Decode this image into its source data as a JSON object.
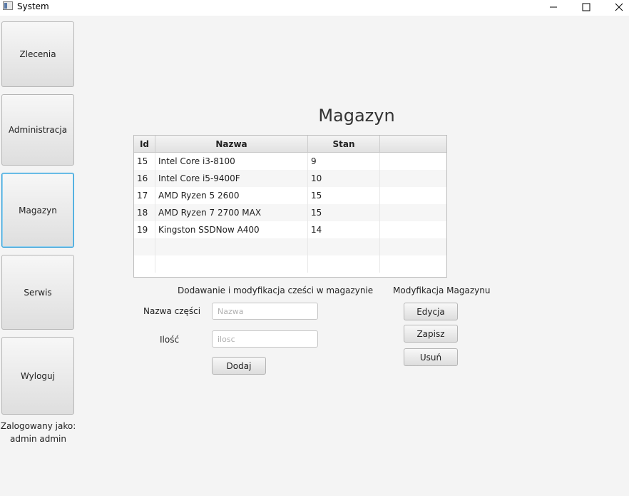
{
  "window": {
    "title": "System"
  },
  "sidebar": {
    "items": [
      {
        "label": "Zlecenia"
      },
      {
        "label": "Administracja"
      },
      {
        "label": "Magazyn"
      },
      {
        "label": "Serwis"
      },
      {
        "label": "Wyloguj"
      }
    ],
    "logged_label": "Zalogowany jako:",
    "logged_user": "admin admin"
  },
  "main": {
    "title": "Magazyn",
    "table": {
      "columns": [
        "Id",
        "Nazwa",
        "Stan",
        ""
      ],
      "rows": [
        {
          "id": "15",
          "nazwa": "Intel Core i3-8100",
          "stan": "9"
        },
        {
          "id": "16",
          "nazwa": "Intel Core i5-9400F",
          "stan": "10"
        },
        {
          "id": "17",
          "nazwa": "AMD Ryzen 5 2600",
          "stan": "15"
        },
        {
          "id": "18",
          "nazwa": "AMD Ryzen 7 2700 MAX",
          "stan": "15"
        },
        {
          "id": "19",
          "nazwa": "Kingston SSDNow A400",
          "stan": "14"
        }
      ]
    },
    "form": {
      "heading": "Dodawanie i modyfikacja cześci w magazynie",
      "name_label": "Nazwa części",
      "name_placeholder": "Nazwa",
      "name_value": "",
      "qty_label": "Ilość",
      "qty_placeholder": "ilosc",
      "qty_value": "",
      "add_label": "Dodaj"
    },
    "modify": {
      "heading": "Modyfikacja Magazynu",
      "edit_label": "Edycja",
      "save_label": "Zapisz",
      "delete_label": "Usuń"
    }
  }
}
